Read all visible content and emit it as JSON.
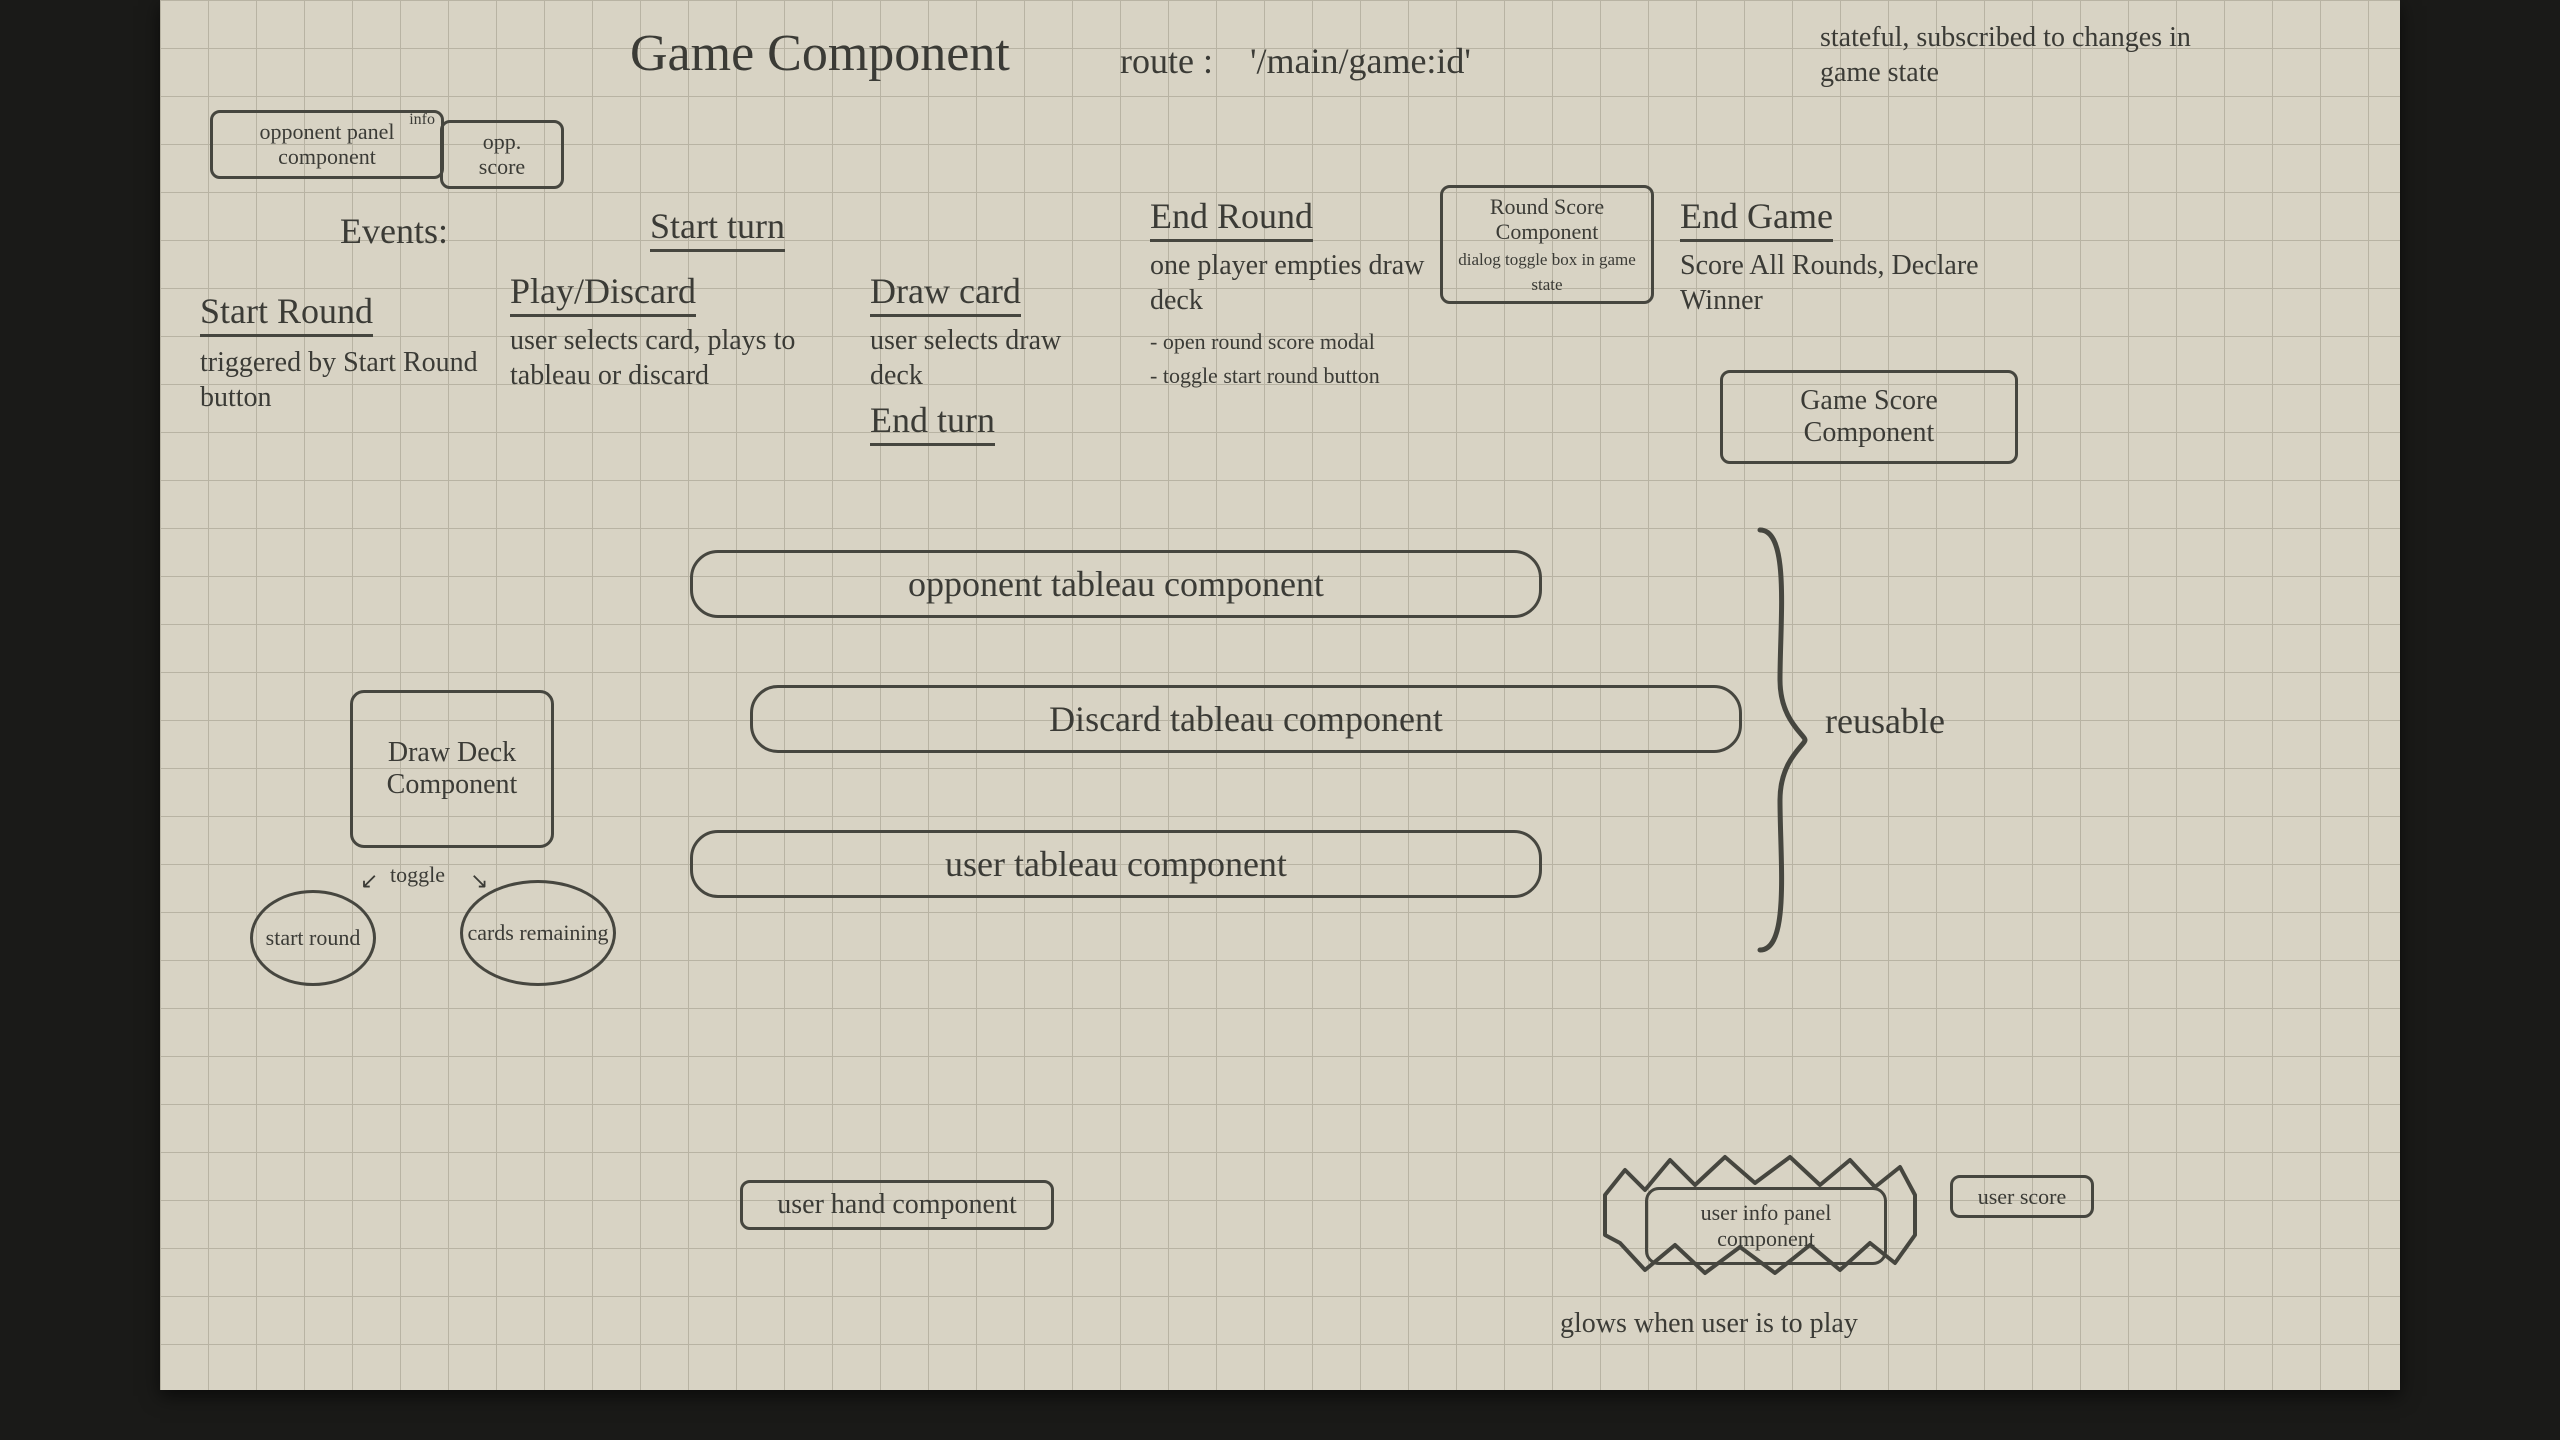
{
  "header": {
    "title": "Game Component",
    "route_label": "route :",
    "route_value": "'/main/game:id'",
    "stateful_note": "stateful, subscribed to changes in game state"
  },
  "top_boxes": {
    "opponent_panel": "opponent panel component",
    "opponent_panel_sup": "info",
    "opp_score": "opp. score",
    "round_score": "Round Score Component",
    "round_score_note": "dialog toggle box in game state",
    "game_score": "Game Score Component"
  },
  "events": {
    "label": "Events:",
    "start_round": {
      "title": "Start Round",
      "body": "triggered by Start Round button"
    },
    "start_turn": {
      "title": "Start turn",
      "play_discard_title": "Play/Discard",
      "play_discard_body": "user selects card, plays to tableau or discard",
      "draw_card_title": "Draw card",
      "draw_card_body": "user selects draw deck",
      "end_turn": "End turn"
    },
    "end_round": {
      "title": "End Round",
      "body": "one player empties draw deck",
      "bullets": [
        "open round score modal",
        "toggle start round button"
      ]
    },
    "end_game": {
      "title": "End Game",
      "body": "Score All Rounds, Declare Winner"
    }
  },
  "tableaus": {
    "opponent": "opponent tableau component",
    "discard": "Discard tableau component",
    "user": "user tableau component",
    "reusable": "reusable"
  },
  "left": {
    "draw_deck": "Draw Deck Component",
    "start_round": "start round",
    "cards_remaining": "cards remaining",
    "toggle": "toggle"
  },
  "bottom": {
    "user_hand": "user hand component",
    "user_info_panel": "user info panel component",
    "user_score": "user score",
    "glow_note": "glows when user is to play"
  }
}
